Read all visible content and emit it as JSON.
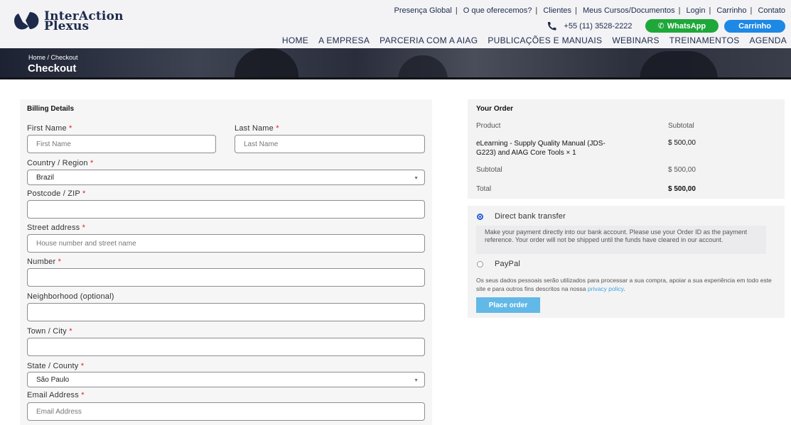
{
  "brand": {
    "line1": "InterAction",
    "line2": "Plexus"
  },
  "top_links": [
    "Presença Global",
    "O que oferecemos?",
    "Clientes",
    "Meus Cursos/Documentos",
    "Login",
    "Carrinho",
    "Contato"
  ],
  "contact": {
    "phone": "+55 (11) 3528-2222",
    "whatsapp_label": "WhatsApp",
    "cart_label": "Carrinho"
  },
  "nav": [
    "HOME",
    "A EMPRESA",
    "PARCERIA COM A AIAG",
    "PUBLICAÇÕES E MANUAIS",
    "WEBINARS",
    "TREINAMENTOS",
    "AGENDA"
  ],
  "banner": {
    "breadcrumb": "Home   / Checkout",
    "title": "Checkout"
  },
  "billing": {
    "heading": "Billing Details",
    "first_name": {
      "label": "First Name",
      "placeholder": "First Name"
    },
    "last_name": {
      "label": "Last Name",
      "placeholder": "Last Name"
    },
    "country": {
      "label": "Country / Region",
      "value": "Brazil"
    },
    "postcode": {
      "label": "Postcode / ZIP",
      "placeholder": ""
    },
    "street": {
      "label": "Street address",
      "placeholder": "House number and street name"
    },
    "number": {
      "label": "Number",
      "placeholder": ""
    },
    "neighborhood": {
      "label": "Neighborhood (optional)",
      "placeholder": ""
    },
    "city": {
      "label": "Town / City",
      "placeholder": ""
    },
    "state": {
      "label": "State / County",
      "value": "São Paulo"
    },
    "email": {
      "label": "Email Address",
      "placeholder": "Email Address"
    },
    "required_mark": "*"
  },
  "order": {
    "heading": "Your Order",
    "col_product": "Product",
    "col_subtotal": "Subtotal",
    "item_name_line1": "eLearning - Supply Quality Manual (JDS-",
    "item_name_line2": "G223) and AIAG Core Tools  × 1",
    "item_price": "$ 500,00",
    "subtotal_label": "Subtotal",
    "subtotal_value": "$ 500,00",
    "total_label": "Total",
    "total_value": "$ 500,00"
  },
  "payment": {
    "option1": "Direct bank transfer",
    "option1_desc": "Make your payment directly into our bank account. Please use your Order ID as the payment reference. Your order will not be shipped until the funds have cleared in our account.",
    "option2": "PayPal",
    "privacy_text": "Os seus dados pessoais serão utilizados para processar a sua compra, apoiar a sua experiência em todo este site e para outros fins descritos na nossa ",
    "privacy_link": "privacy policy",
    "privacy_end": ".",
    "place_order": "Place order"
  },
  "colors": {
    "brand_navy": "#1d2a4a",
    "whatsapp_green": "#1ea83a",
    "cart_blue": "#1e88e5",
    "place_order": "#62b8e6",
    "required": "#e02020"
  }
}
